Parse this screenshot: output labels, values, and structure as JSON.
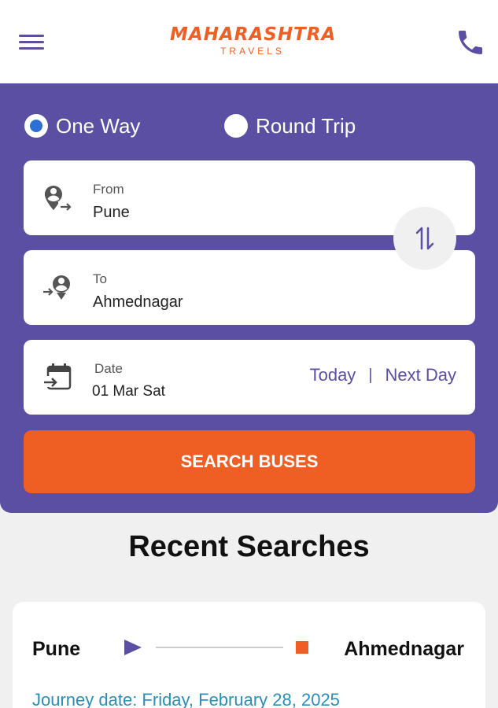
{
  "header": {
    "logo_main": "MAHARASHTRA",
    "logo_sub": "TRAVELS",
    "menu_icon": "hamburger-menu-icon",
    "phone_icon": "phone-icon"
  },
  "trip_type": {
    "one_way_label": "One Way",
    "round_trip_label": "Round Trip",
    "selected": "One Way"
  },
  "from": {
    "label": "From",
    "value": "Pune"
  },
  "to": {
    "label": "To",
    "value": "Ahmednagar"
  },
  "date": {
    "label": "Date",
    "value": "01 Mar Sat",
    "today_label": "Today",
    "separator": "|",
    "next_day_label": "Next Day"
  },
  "search_button_label": "SEARCH BUSES",
  "recent": {
    "title": "Recent Searches",
    "items": [
      {
        "from": "Pune",
        "to": "Ahmednagar",
        "journey_date": "Journey date: Friday, February 28, 2025"
      }
    ]
  },
  "colors": {
    "brand_purple": "#5a4fa3",
    "brand_orange": "#ef5f24",
    "link_blue": "#2a8fb8",
    "radio_selected": "#2e6fd6"
  }
}
